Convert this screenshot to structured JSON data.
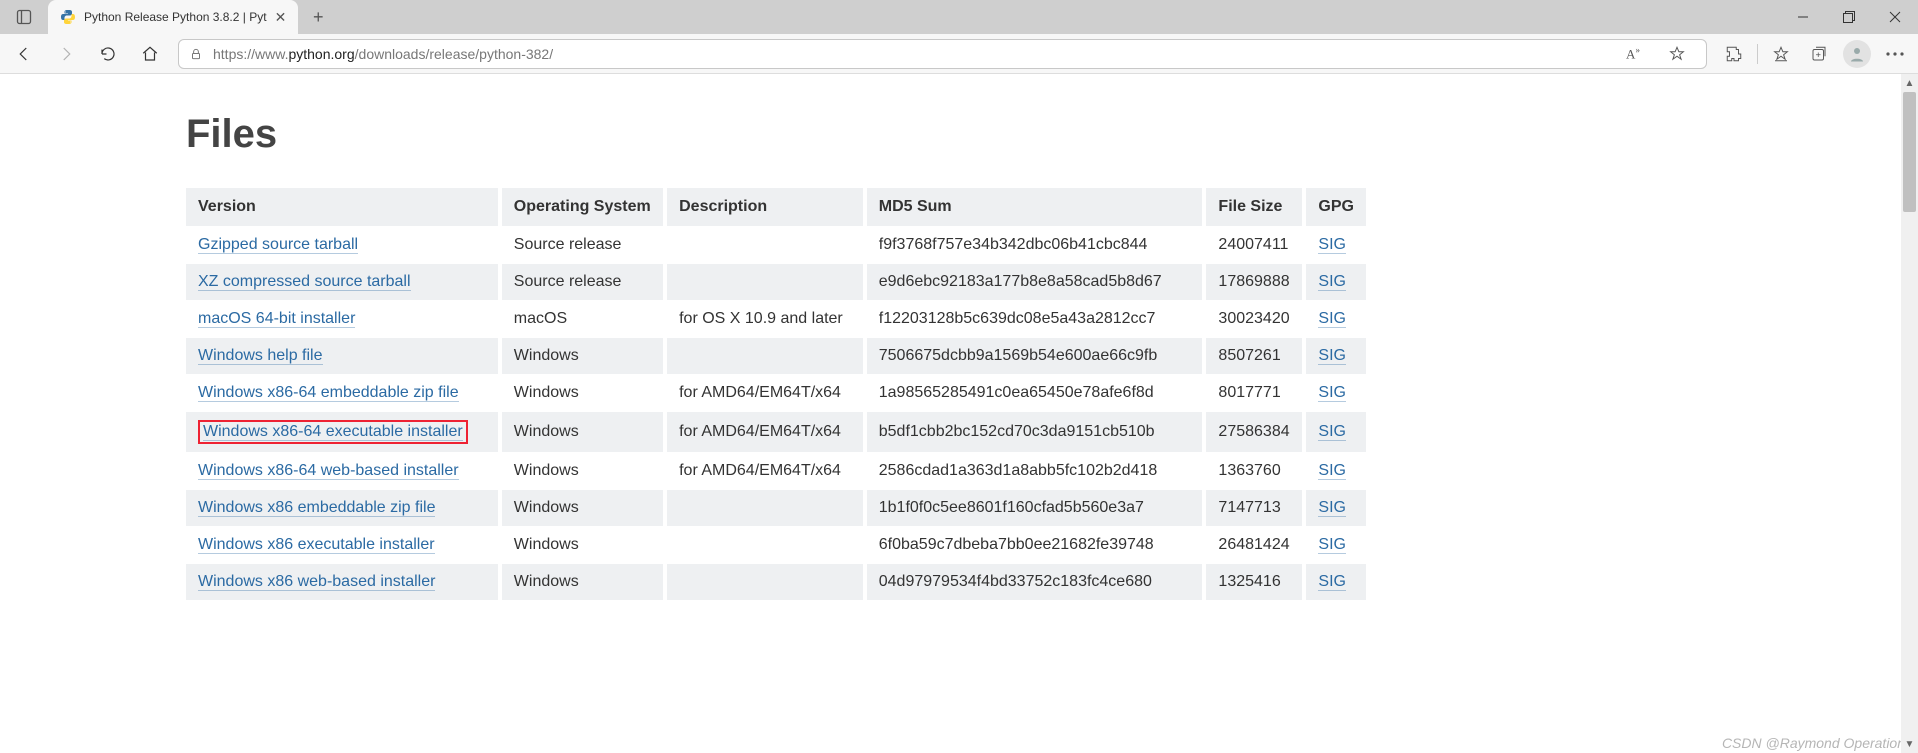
{
  "browser": {
    "tab_title": "Python Release Python 3.8.2 | Pyt",
    "url_prefix": "https://www.",
    "url_bold": "python.org",
    "url_suffix": "/downloads/release/python-382/"
  },
  "page": {
    "heading": "Files",
    "watermark": "CSDN @Raymond Operations"
  },
  "table": {
    "headers": {
      "version": "Version",
      "os": "Operating System",
      "desc": "Description",
      "md5": "MD5 Sum",
      "size": "File Size",
      "gpg": "GPG"
    },
    "sig_label": "SIG",
    "highlight_index": 5,
    "rows": [
      {
        "version": "Gzipped source tarball",
        "os": "Source release",
        "desc": "",
        "md5": "f9f3768f757e34b342dbc06b41cbc844",
        "size": "24007411"
      },
      {
        "version": "XZ compressed source tarball",
        "os": "Source release",
        "desc": "",
        "md5": "e9d6ebc92183a177b8e8a58cad5b8d67",
        "size": "17869888"
      },
      {
        "version": "macOS 64-bit installer",
        "os": "macOS",
        "desc": "for OS X 10.9 and later",
        "md5": "f12203128b5c639dc08e5a43a2812cc7",
        "size": "30023420"
      },
      {
        "version": "Windows help file",
        "os": "Windows",
        "desc": "",
        "md5": "7506675dcbb9a1569b54e600ae66c9fb",
        "size": "8507261"
      },
      {
        "version": "Windows x86-64 embeddable zip file",
        "os": "Windows",
        "desc": "for AMD64/EM64T/x64",
        "md5": "1a98565285491c0ea65450e78afe6f8d",
        "size": "8017771"
      },
      {
        "version": "Windows x86-64 executable installer",
        "os": "Windows",
        "desc": "for AMD64/EM64T/x64",
        "md5": "b5df1cbb2bc152cd70c3da9151cb510b",
        "size": "27586384"
      },
      {
        "version": "Windows x86-64 web-based installer",
        "os": "Windows",
        "desc": "for AMD64/EM64T/x64",
        "md5": "2586cdad1a363d1a8abb5fc102b2d418",
        "size": "1363760"
      },
      {
        "version": "Windows x86 embeddable zip file",
        "os": "Windows",
        "desc": "",
        "md5": "1b1f0f0c5ee8601f160cfad5b560e3a7",
        "size": "7147713"
      },
      {
        "version": "Windows x86 executable installer",
        "os": "Windows",
        "desc": "",
        "md5": "6f0ba59c7dbeba7bb0ee21682fe39748",
        "size": "26481424"
      },
      {
        "version": "Windows x86 web-based installer",
        "os": "Windows",
        "desc": "",
        "md5": "04d97979534f4bd33752c183fc4ce680",
        "size": "1325416"
      }
    ]
  }
}
